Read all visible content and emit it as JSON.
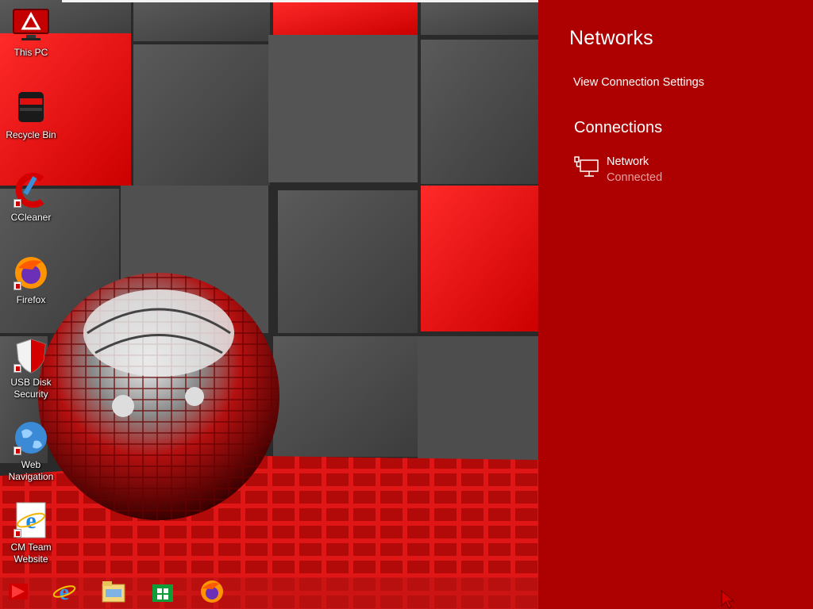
{
  "desktop": {
    "icons": [
      {
        "label": "This PC",
        "icon": "monitor-icon"
      },
      {
        "label": "Recycle Bin",
        "icon": "recycle-bin-icon"
      },
      {
        "label": "CCleaner",
        "icon": "ccleaner-icon"
      },
      {
        "label": "Firefox",
        "icon": "firefox-icon"
      },
      {
        "label": "USB Disk\nSecurity",
        "icon": "shield-icon"
      },
      {
        "label": "Web\nNavigation",
        "icon": "globe-icon"
      },
      {
        "label": "CM Team\nWebsite",
        "icon": "internet-explorer-icon"
      }
    ]
  },
  "taskbar": {
    "items": [
      {
        "icon": "start-icon"
      },
      {
        "icon": "internet-explorer-icon"
      },
      {
        "icon": "file-explorer-icon"
      },
      {
        "icon": "store-icon"
      },
      {
        "icon": "firefox-icon"
      }
    ]
  },
  "network_panel": {
    "title": "Networks",
    "view_settings_label": "View Connection Settings",
    "connections_heading": "Connections",
    "connection": {
      "name": "Network",
      "status": "Connected",
      "icon": "ethernet-icon"
    }
  },
  "colors": {
    "panel_bg": "#ad0000",
    "accent_red": "#e8191c",
    "cube_gray": "#4a4a4a",
    "status_text": "#e6a0a0"
  }
}
